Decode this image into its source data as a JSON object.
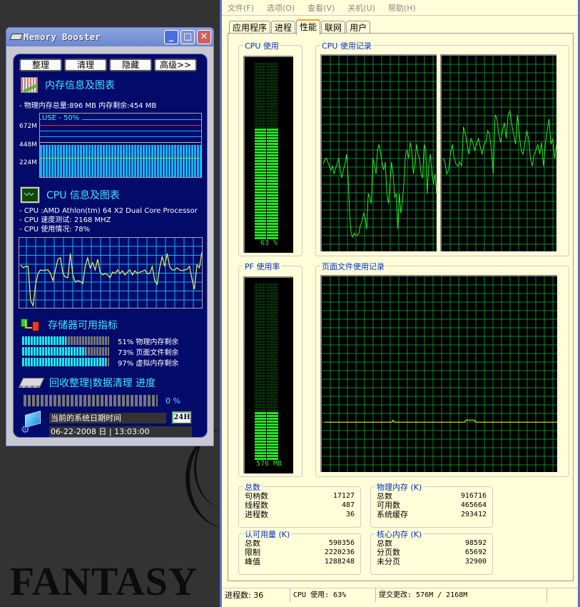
{
  "desktop": {
    "wallpaper_text": "FANTASY"
  },
  "memory_booster": {
    "title": "Memory Booster",
    "window_buttons": {
      "minimize": "_",
      "maximize": "□",
      "close": "✕"
    },
    "toolbar": [
      "整理",
      "清理",
      "隐藏",
      "高级>>"
    ],
    "memory_section": {
      "heading": "内存信息及图表",
      "summary": "- 物理内存总量:896 MB  内存剩余:454 MB",
      "chart_label": "USE - 50%",
      "y_labels": [
        "672M",
        "448M",
        "224M"
      ],
      "use_percent": 50
    },
    "cpu_section": {
      "heading": "CPU 信息及图表",
      "lines": [
        "- CPU :AMD Athlon(tm) 64 X2 Dual Core Processor",
        "- CPU 速度测试: 2168 MHZ",
        "- CPU 使用情况:  78%"
      ],
      "history": [
        62,
        58,
        60,
        60,
        12,
        5,
        35,
        50,
        55,
        54,
        55,
        55,
        50,
        40,
        55,
        70,
        72,
        50,
        45,
        44,
        78,
        48,
        38,
        40,
        39,
        36,
        60,
        72,
        58,
        65,
        55,
        70,
        52,
        48,
        50,
        48,
        44,
        52,
        50,
        55,
        50,
        54,
        48,
        52,
        55,
        48,
        54,
        50,
        52,
        53,
        55,
        50,
        50,
        60,
        40,
        35,
        58,
        74,
        60,
        78,
        60,
        55,
        55,
        58,
        55,
        54,
        55,
        56,
        60,
        42,
        28,
        62,
        58,
        80
      ]
    },
    "storage_section": {
      "heading": "存储器可用指标",
      "bars": [
        {
          "percent": 51,
          "label": "51% 物理内存剩余"
        },
        {
          "percent": 73,
          "label": "73% 页面文件剩余"
        },
        {
          "percent": 97,
          "label": "97% 虚拟内存剩余"
        }
      ]
    },
    "cleanup_section": {
      "heading": "回收整理|数据清理 进度",
      "progress_percent": 0,
      "progress_text": "0 %"
    },
    "clock": {
      "label": "当前的系统日期时间",
      "mode_button": "24H",
      "value": "06-22-2008  日 | 13:03:00"
    }
  },
  "task_manager": {
    "menu": [
      "文件(F)",
      "选项(O)",
      "查看(V)",
      "关机(U)",
      "帮助(H)"
    ],
    "tabs": [
      {
        "label": "应用程序",
        "active": false
      },
      {
        "label": "进程",
        "active": false
      },
      {
        "label": "性能",
        "active": true
      },
      {
        "label": "联网",
        "active": false
      },
      {
        "label": "用户",
        "active": false
      }
    ],
    "cpu_usage": {
      "title": "CPU 使用",
      "percent": 63,
      "text": "63 %"
    },
    "cpu_history": {
      "title": "CPU 使用记录",
      "core1": [
        45,
        47,
        48,
        46,
        44,
        42,
        44,
        40,
        43,
        45,
        48,
        42,
        38,
        42,
        45,
        50,
        40,
        20,
        10,
        8,
        10,
        9,
        9,
        10,
        14,
        16,
        20,
        18,
        12,
        30,
        28,
        25,
        48,
        45,
        40,
        52,
        55,
        50,
        45,
        42,
        46,
        30,
        25,
        35,
        46,
        40,
        28,
        30,
        12,
        30,
        20,
        26,
        36,
        50,
        52,
        48,
        56,
        52,
        40,
        45,
        55,
        50,
        48,
        40,
        38,
        55,
        52,
        30,
        45,
        50,
        40,
        35,
        40,
        30
      ],
      "core2": [
        48,
        46,
        40,
        42,
        50,
        55,
        48,
        45,
        44,
        46,
        44,
        64,
        60,
        55,
        50,
        58,
        56,
        52,
        55,
        58,
        54,
        50,
        55,
        56,
        62,
        60,
        52,
        40,
        70,
        68,
        60,
        56,
        62,
        66,
        58,
        70,
        72,
        65,
        60,
        55,
        70,
        60,
        52,
        50,
        56,
        62,
        58,
        48,
        44,
        50,
        52,
        55,
        50,
        56,
        44,
        55,
        62,
        68,
        55,
        58,
        48,
        55
      ]
    },
    "pf_usage": {
      "title": "PF 使用率",
      "fraction": 0.27,
      "text": "576 MB"
    },
    "pf_history": {
      "title": "页面文件使用记录",
      "level_fraction": 0.26
    },
    "totals": {
      "title": "总数",
      "rows": [
        {
          "k": "句柄数",
          "v": "17127"
        },
        {
          "k": "线程数",
          "v": "487"
        },
        {
          "k": "进程数",
          "v": "36"
        }
      ]
    },
    "physical_memory": {
      "title": "物理内存 (K)",
      "rows": [
        {
          "k": "总数",
          "v": "916716"
        },
        {
          "k": "可用数",
          "v": "465664"
        },
        {
          "k": "系统缓存",
          "v": "293412"
        }
      ]
    },
    "commit_charge": {
      "title": "认可用量 (K)",
      "rows": [
        {
          "k": "总数",
          "v": "590356"
        },
        {
          "k": "限制",
          "v": "2220236"
        },
        {
          "k": "峰值",
          "v": "1288248"
        }
      ]
    },
    "kernel_memory": {
      "title": "核心内存 (K)",
      "rows": [
        {
          "k": "总数",
          "v": "98592"
        },
        {
          "k": "分页数",
          "v": "65692"
        },
        {
          "k": "未分页",
          "v": "32900"
        }
      ]
    },
    "status_bar": {
      "processes": "进程数: 36",
      "cpu": "CPU 使用: 63%",
      "commit": "提交更改: 576M / 2168M"
    }
  }
}
